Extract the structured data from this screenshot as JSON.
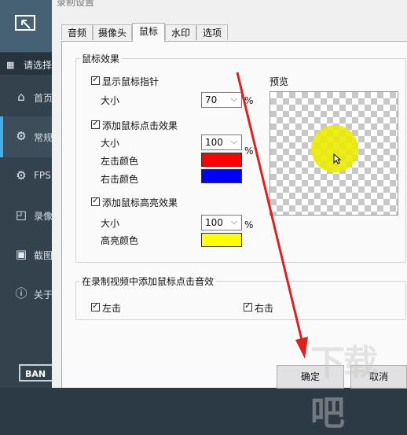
{
  "sidebar": {
    "select_label": "请选择",
    "items": [
      {
        "label": "首页",
        "icon": "home-icon"
      },
      {
        "label": "常规",
        "icon": "gear-icon"
      },
      {
        "label": "FPS",
        "icon": "fps-gear-icon"
      },
      {
        "label": "录像",
        "icon": "record-icon"
      },
      {
        "label": "截图",
        "icon": "screenshot-icon"
      },
      {
        "label": "关于",
        "icon": "info-icon"
      }
    ],
    "brand": "BAN"
  },
  "dialog": {
    "title": "录制设置",
    "tabs": [
      "音频",
      "摄像头",
      "鼠标",
      "水印",
      "选项"
    ],
    "active_tab": "鼠标",
    "mouse_effects": {
      "group_title": "鼠标效果",
      "show_pointer": {
        "label": "显示鼠标指针",
        "checked": true
      },
      "pointer_size": {
        "label": "大小",
        "value": "70",
        "unit": "%"
      },
      "click_effect": {
        "label": "添加鼠标点击效果",
        "checked": true
      },
      "click_size": {
        "label": "大小",
        "value": "100",
        "unit": "%"
      },
      "left_click_color": {
        "label": "左击颜色",
        "color": "#ff0000"
      },
      "right_click_color": {
        "label": "右击颜色",
        "color": "#0000ff"
      },
      "highlight_effect": {
        "label": "添加鼠标高亮效果",
        "checked": true
      },
      "highlight_size": {
        "label": "大小",
        "value": "100",
        "unit": "%"
      },
      "highlight_color": {
        "label": "高亮颜色",
        "color": "#ffff00"
      }
    },
    "preview_label": "预览",
    "click_sound": {
      "group_title": "在录制视频中添加鼠标点击音效",
      "left": {
        "label": "左击",
        "checked": true
      },
      "right": {
        "label": "右击",
        "checked": true
      }
    },
    "ok_label": "确定",
    "cancel_label": "取消"
  },
  "watermark_text": "下载吧"
}
